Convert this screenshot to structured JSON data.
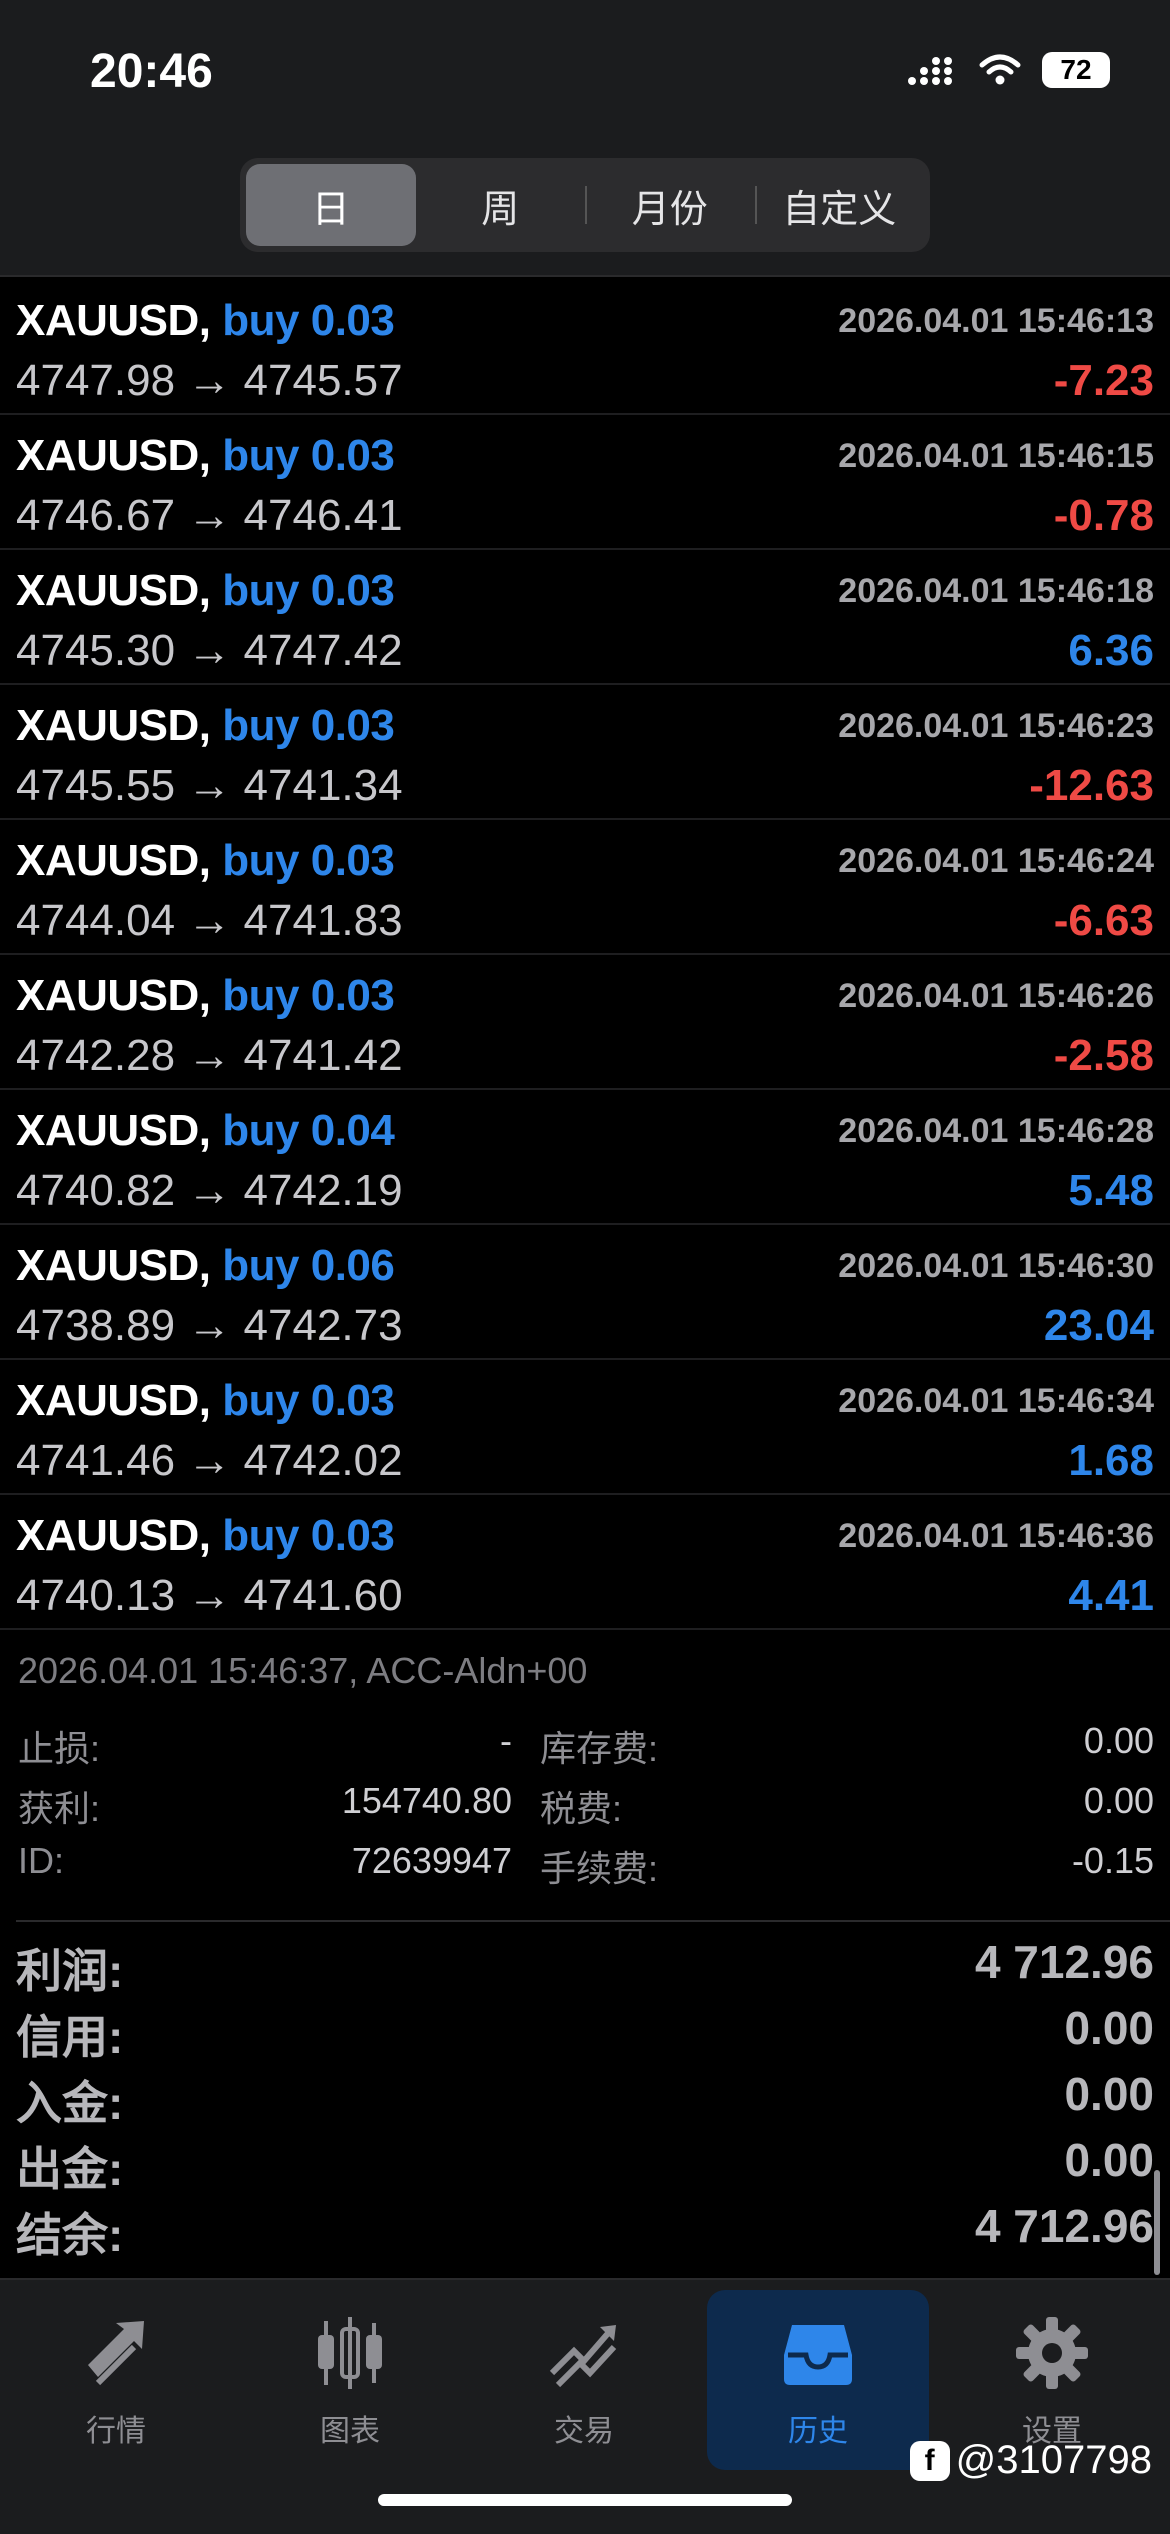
{
  "status_bar": {
    "time": "20:46",
    "battery": "72"
  },
  "segments": [
    {
      "label": "日",
      "active": true
    },
    {
      "label": "周",
      "active": false
    },
    {
      "label": "月份",
      "active": false
    },
    {
      "label": "自定义",
      "active": false
    }
  ],
  "deals": [
    {
      "symbol": "XAUUSD,",
      "side": "buy",
      "volume": "0.03",
      "time": "2026.04.01 15:46:13",
      "open": "4747.98",
      "close": "4745.57",
      "profit": "-7.23"
    },
    {
      "symbol": "XAUUSD,",
      "side": "buy",
      "volume": "0.03",
      "time": "2026.04.01 15:46:15",
      "open": "4746.67",
      "close": "4746.41",
      "profit": "-0.78"
    },
    {
      "symbol": "XAUUSD,",
      "side": "buy",
      "volume": "0.03",
      "time": "2026.04.01 15:46:18",
      "open": "4745.30",
      "close": "4747.42",
      "profit": "6.36"
    },
    {
      "symbol": "XAUUSD,",
      "side": "buy",
      "volume": "0.03",
      "time": "2026.04.01 15:46:23",
      "open": "4745.55",
      "close": "4741.34",
      "profit": "-12.63"
    },
    {
      "symbol": "XAUUSD,",
      "side": "buy",
      "volume": "0.03",
      "time": "2026.04.01 15:46:24",
      "open": "4744.04",
      "close": "4741.83",
      "profit": "-6.63"
    },
    {
      "symbol": "XAUUSD,",
      "side": "buy",
      "volume": "0.03",
      "time": "2026.04.01 15:46:26",
      "open": "4742.28",
      "close": "4741.42",
      "profit": "-2.58"
    },
    {
      "symbol": "XAUUSD,",
      "side": "buy",
      "volume": "0.04",
      "time": "2026.04.01 15:46:28",
      "open": "4740.82",
      "close": "4742.19",
      "profit": "5.48"
    },
    {
      "symbol": "XAUUSD,",
      "side": "buy",
      "volume": "0.06",
      "time": "2026.04.01 15:46:30",
      "open": "4738.89",
      "close": "4742.73",
      "profit": "23.04"
    },
    {
      "symbol": "XAUUSD,",
      "side": "buy",
      "volume": "0.03",
      "time": "2026.04.01 15:46:34",
      "open": "4741.46",
      "close": "4742.02",
      "profit": "1.68"
    },
    {
      "symbol": "XAUUSD,",
      "side": "buy",
      "volume": "0.03",
      "time": "2026.04.01 15:46:36",
      "open": "4740.13",
      "close": "4741.60",
      "profit": "4.41"
    }
  ],
  "arrow": "→",
  "detail": {
    "header": "2026.04.01 15:46:37, ACC-Aldn+00",
    "stop_loss_label": "止损:",
    "stop_loss_value": "-",
    "swap_label": "库存费:",
    "swap_value": "0.00",
    "take_profit_label": "获利:",
    "take_profit_value": "154740.80",
    "tax_label": "税费:",
    "tax_value": "0.00",
    "id_label": "ID:",
    "id_value": "72639947",
    "commission_label": "手续费:",
    "commission_value": "-0.15"
  },
  "summary": [
    {
      "label": "利润:",
      "value": "4 712.96"
    },
    {
      "label": "信用:",
      "value": "0.00"
    },
    {
      "label": "入金:",
      "value": "0.00"
    },
    {
      "label": "出金:",
      "value": "0.00"
    },
    {
      "label": "结余:",
      "value": "4 712.96"
    }
  ],
  "tabs": [
    {
      "label": "行情",
      "icon": "quotes-icon",
      "active": false
    },
    {
      "label": "图表",
      "icon": "chart-icon",
      "active": false
    },
    {
      "label": "交易",
      "icon": "trade-icon",
      "active": false
    },
    {
      "label": "历史",
      "icon": "history-icon",
      "active": true
    },
    {
      "label": "设置",
      "icon": "settings-icon",
      "active": false
    }
  ],
  "watermark": "@3107798",
  "colors": {
    "negative": "#ef4a45",
    "positive": "#2e86ea",
    "accent": "#2e86ea"
  }
}
